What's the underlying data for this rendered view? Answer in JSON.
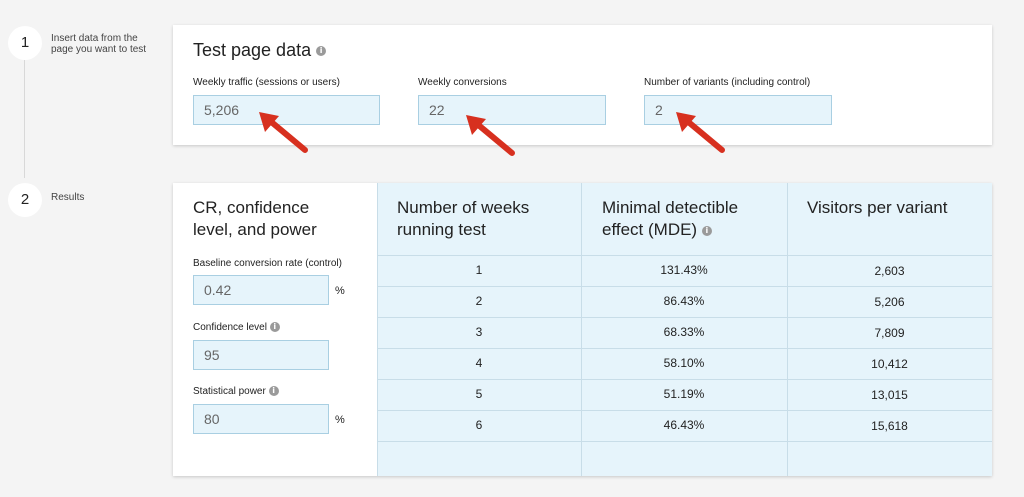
{
  "steps": [
    {
      "number": "1",
      "text": "Insert data from the page you want to test"
    },
    {
      "number": "2",
      "text": "Results"
    }
  ],
  "test_page": {
    "title": "Test page data",
    "info_icon": "info-icon",
    "fields": [
      {
        "label": "Weekly traffic (sessions or users)",
        "value": "5,206"
      },
      {
        "label": "Weekly conversions",
        "value": "22"
      },
      {
        "label": "Number of variants (including control)",
        "value": "2"
      }
    ]
  },
  "settings": {
    "title": "CR, confidence level, and power",
    "baseline": {
      "label": "Baseline conversion rate (control)",
      "value": "0.42",
      "unit": "%"
    },
    "confidence": {
      "label": "Confidence level",
      "value": "95"
    },
    "power": {
      "label": "Statistical power",
      "value": "80",
      "unit": "%"
    }
  },
  "results": {
    "headers": [
      "Number of weeks running test",
      "Minimal detectible effect (MDE)",
      "Visitors per variant"
    ],
    "rows": [
      {
        "weeks": "1",
        "mde": "131.43%",
        "visitors": "2,603"
      },
      {
        "weeks": "2",
        "mde": "86.43%",
        "visitors": "5,206"
      },
      {
        "weeks": "3",
        "mde": "68.33%",
        "visitors": "7,809"
      },
      {
        "weeks": "4",
        "mde": "58.10%",
        "visitors": "10,412"
      },
      {
        "weeks": "5",
        "mde": "51.19%",
        "visitors": "13,015"
      },
      {
        "weeks": "6",
        "mde": "46.43%",
        "visitors": "15,618"
      }
    ]
  },
  "colors": {
    "arrow": "#d7301f",
    "input_bg": "#e6f4fb",
    "table_bg": "#e6f4fb"
  }
}
